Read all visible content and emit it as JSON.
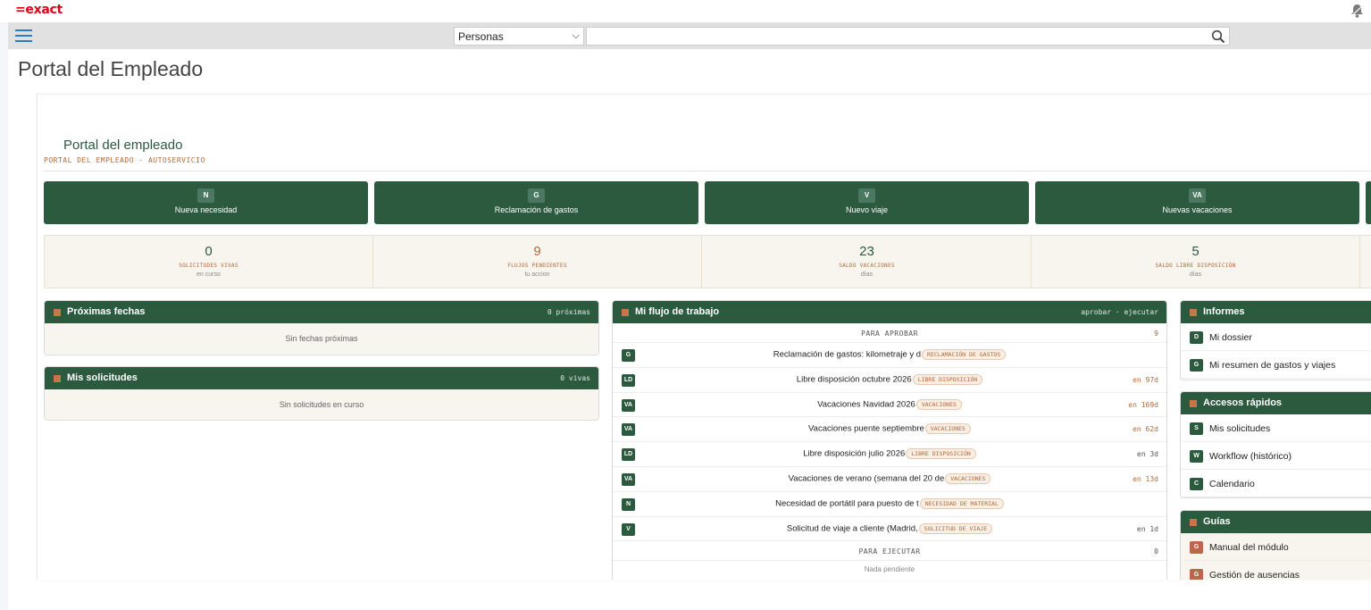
{
  "app": {
    "logo": "=exact"
  },
  "nav": {
    "select_value": "Personas",
    "search_placeholder": ""
  },
  "page_title": "Portal del Empleado",
  "portal": {
    "title": "Portal del empleado",
    "subtitle": "PORTAL DEL EMPLEADO · AUTOSERVICIO"
  },
  "actions": [
    {
      "badge": "N",
      "label": "Nueva necesidad"
    },
    {
      "badge": "G",
      "label": "Reclamación de gastos"
    },
    {
      "badge": "V",
      "label": "Nuevo viaje"
    },
    {
      "badge": "VA",
      "label": "Nuevas vacaciones"
    }
  ],
  "stats": [
    {
      "value": "0",
      "key": "SOLICITUDES VIVAS",
      "sub": "en curso"
    },
    {
      "value": "9",
      "key": "FLUJOS PENDIENTES",
      "sub": "tu accion"
    },
    {
      "value": "23",
      "key": "SALDO VACACIONES",
      "sub": "días"
    },
    {
      "value": "5",
      "key": "SALDO LIBRE DISPOSICIÓN",
      "sub": "días"
    }
  ],
  "proximas": {
    "title": "Próximas fechas",
    "count": "0 próximas",
    "empty": "Sin fechas próximas"
  },
  "solicitudes": {
    "title": "Mis solicitudes",
    "count": "0 vivas",
    "empty": "Sin solicitudes en curso"
  },
  "workflow": {
    "title": "Mi flujo de trabajo",
    "hint": "aprobar · ejecutar",
    "section_approve": {
      "label": "PARA APROBAR",
      "count": "9"
    },
    "rows": [
      {
        "badge": "G",
        "text": "Reclamación de gastos: kilometraje y d",
        "tag": "RECLAMACIÓN DE GASTOS",
        "due": ""
      },
      {
        "badge": "LD",
        "text": "Libre disposición octubre 2026",
        "tag": "LIBRE DISPOSICIÓN",
        "due": "en 97d"
      },
      {
        "badge": "VA",
        "text": "Vacaciones Navidad 2026",
        "tag": "VACACIONES",
        "due": "en 169d"
      },
      {
        "badge": "VA",
        "text": "Vacaciones puente septiembre",
        "tag": "VACACIONES",
        "due": "en 62d"
      },
      {
        "badge": "LD",
        "text": "Libre disposición julio 2026",
        "tag": "LIBRE DISPOSICIÓN",
        "due": "en 3d"
      },
      {
        "badge": "VA",
        "text": "Vacaciones de verano (semana del 20 de",
        "tag": "VACACIONES",
        "due": "en 13d"
      },
      {
        "badge": "N",
        "text": "Necesidad de portátil para puesto de t",
        "tag": "NECESIDAD DE MATERIAL",
        "due": ""
      },
      {
        "badge": "V",
        "text": "Solicitud de viaje a cliente (Madrid,",
        "tag": "SOLICITUD DE VIAJE",
        "due": "en 1d"
      }
    ],
    "section_execute": {
      "label": "PARA EJECUTAR",
      "count": "0"
    },
    "execute_empty": "Nada pendiente"
  },
  "informes": {
    "title": "Informes",
    "items": [
      {
        "badge": "D",
        "label": "Mi dossier"
      },
      {
        "badge": "G",
        "label": "Mi resumen de gastos y viajes"
      }
    ]
  },
  "accesos": {
    "title": "Accesos rápidos",
    "items": [
      {
        "badge": "S",
        "label": "Mis solicitudes"
      },
      {
        "badge": "W",
        "label": "Workflow (histórico)"
      },
      {
        "badge": "C",
        "label": "Calendario"
      }
    ]
  },
  "guias": {
    "title": "Guías",
    "items": [
      {
        "badge": "G",
        "label": "Manual del módulo"
      },
      {
        "badge": "G",
        "label": "Gestión de ausencias"
      }
    ]
  }
}
